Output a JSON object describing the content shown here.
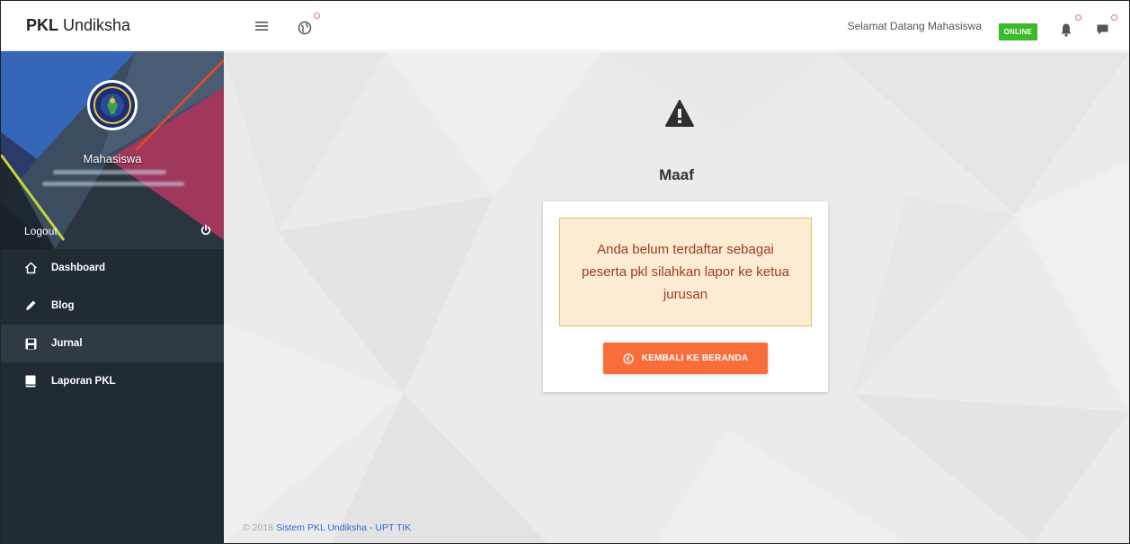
{
  "brand": {
    "bold": "PKL",
    "name": "Undiksha"
  },
  "profile": {
    "name": "Mahasiswa",
    "logout_label": "Logout",
    "power_icon": "power-icon"
  },
  "menu": [
    {
      "label": "Dashboard",
      "icon": "home-icon",
      "active": false
    },
    {
      "label": "Blog",
      "icon": "pencil-icon",
      "active": false
    },
    {
      "label": "Jurnal",
      "icon": "save-icon",
      "active": true
    },
    {
      "label": "Laporan PKL",
      "icon": "book-icon",
      "active": false
    }
  ],
  "topbar": {
    "menu_icon": "hamburger-icon",
    "globe_icon": "globe-icon",
    "welcome_text": "Selamat Datang Mahasiswa",
    "status_badge": "ONLINE",
    "bell_icon": "bell-icon",
    "chat_icon": "chat-icon"
  },
  "main": {
    "heading": "Maaf",
    "alert_message": "Anda belum terdaftar sebagai peserta pkl silahkan lapor ke ketua jurusan",
    "back_button": "KEMBALI KE BERANDA"
  },
  "footer": {
    "copyright": "© 2018",
    "link_text": "Sistem PKL Undiksha - UPT TIK"
  },
  "colors": {
    "sidebar_bg": "#212b32",
    "active_item_bg": "#2f3a42",
    "online_badge": "#3bba2b",
    "alert_bg": "#fcecd4",
    "alert_text": "#a33b20",
    "button_bg": "#f96d3b",
    "link": "#2f6ad6"
  }
}
